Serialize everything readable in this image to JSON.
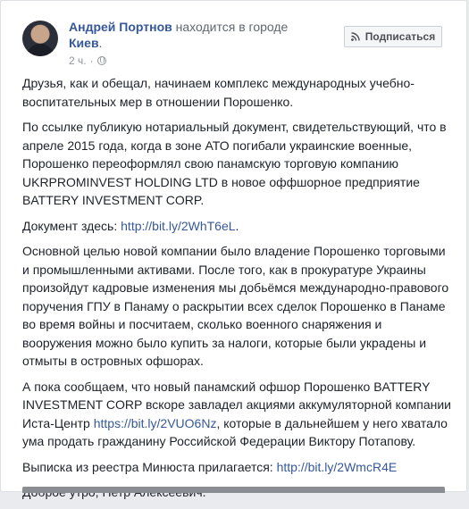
{
  "header": {
    "author_name": "Андрей Портнов",
    "action_text": " находится в городе",
    "location": "Киев",
    "timestamp": "2 ч.",
    "subscribe_label": "Подписаться"
  },
  "post": {
    "p1": "Друзья, как и обещал, начинаем комплекс международных учебно-воспитательных мер в отношении Порошенко.",
    "p2": "По ссылке публикую нотариальный документ, свидетельствующий, что в апреле 2015 года, когда в зоне АТО погибали украинские военные, Порошенко переоформлял свою панамскую торговую компанию UKRPROMINVEST HOLDING LTD в новое оффшорное предприятие BATTERY INVESTMENT CORP.",
    "p3_prefix": "Документ здесь: ",
    "p3_link": "http://bit.ly/2WhT6eL",
    "p3_suffix": ".",
    "p4": "Основной целью новой компании было владение Порошенко торговыми и промышленными активами. После того, как в прокуратуре Украины произойдут кадровые изменения мы добьёмся международно-правового поручения ГПУ в Панаму о раскрытии всех сделок Порошенко в Панаме во время войны и посчитаем, сколько военного снаряжения и вооружения можно было купить за налоги, которые были украдены и отмыты в островных офшорах.",
    "p5_prefix": "А пока сообщаем, что новый панамский офшор Порошенко BATTERY INVESTMENT CORP вскоре завладел акциями аккумуляторной компании Иста-Центр ",
    "p5_link": "https://bit.ly/2VUO6Nz",
    "p5_suffix": ", которые в дальнейшем у него хватало ума продать гражданину Российской Федерации Виктору Потапову.",
    "p6_prefix": "Выписка из реестра Минюста прилагается: ",
    "p6_link": "http://bit.ly/2WmcR4E",
    "p7": "Доброе утро, Петр Алексеевич."
  },
  "icons": {
    "privacy": "globe-icon",
    "subscribe": "rss-icon"
  },
  "colors": {
    "link": "#365899",
    "text": "#1d2129",
    "meta": "#90949c"
  }
}
